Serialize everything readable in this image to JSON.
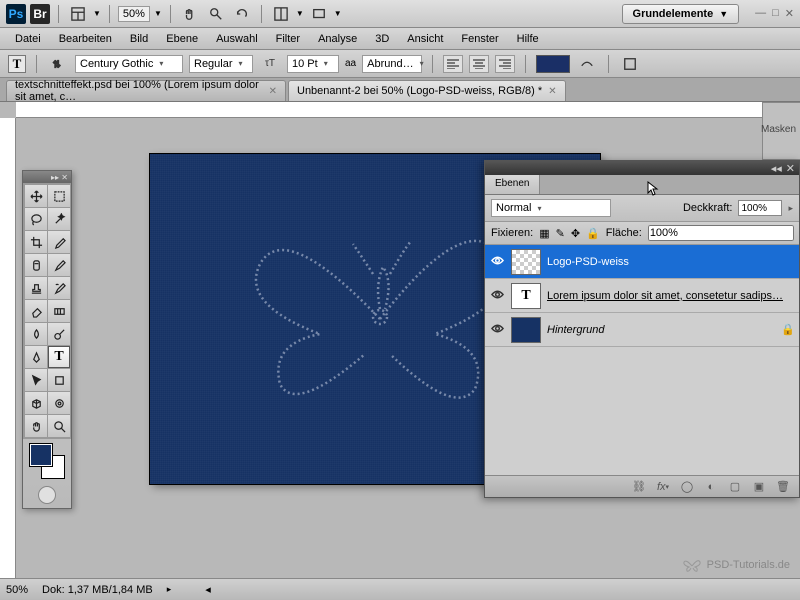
{
  "topbar": {
    "zoom": "50%",
    "workspace": "Grundelemente"
  },
  "menu": [
    "Datei",
    "Bearbeiten",
    "Bild",
    "Ebene",
    "Auswahl",
    "Filter",
    "Analyse",
    "3D",
    "Ansicht",
    "Fenster",
    "Hilfe"
  ],
  "options": {
    "font": "Century Gothic",
    "weight": "Regular",
    "size": "10 Pt",
    "aa_label": "aa",
    "aa": "Abrund…"
  },
  "tabs": [
    {
      "label": "textschnitteffekt.psd bei 100% (Lorem ipsum dolor sit amet, c…",
      "active": false
    },
    {
      "label": "Unbenannt-2 bei 50% (Logo-PSD-weiss, RGB/8) *",
      "active": true
    }
  ],
  "sidepanel": {
    "masken": "Masken"
  },
  "layers_panel": {
    "tab": "Ebenen",
    "blend": "Normal",
    "opacity_label": "Deckkraft:",
    "opacity": "100%",
    "lock_label": "Fixieren:",
    "fill_label": "Fläche:",
    "fill": "100%",
    "layers": [
      {
        "name": "Logo-PSD-weiss",
        "selected": true,
        "thumb": "chk"
      },
      {
        "name": "Lorem ipsum dolor sit amet, consetetur sadips…",
        "selected": false,
        "thumb": "T",
        "ul": true
      },
      {
        "name": "Hintergrund",
        "selected": false,
        "thumb": "blue",
        "italic": true,
        "locked": true
      }
    ]
  },
  "status": {
    "zoom": "50%",
    "docinfo": "Dok: 1,37 MB/1,84 MB"
  },
  "watermark": "PSD-Tutorials.de"
}
